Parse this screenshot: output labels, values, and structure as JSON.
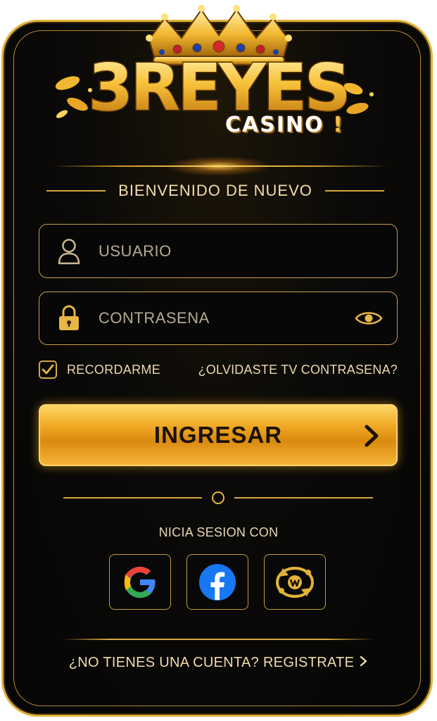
{
  "brand": {
    "logo_main": "3REYES",
    "logo_sub": "CASINO",
    "logo_sub_mark": "!"
  },
  "form": {
    "welcome": "BIENVENIDO DE NUEVO",
    "username_placeholder": "USUARIO",
    "password_placeholder": "CONTRASENA",
    "remember_label": "RECORDARME",
    "remember_checked": true,
    "forgot_link": "¿OLVIDASTE TV CONTRASENA?",
    "login_button": "INGRESAR"
  },
  "social": {
    "label": "NICIA SESION CON",
    "providers": [
      {
        "name": "google",
        "icon": "google-icon"
      },
      {
        "name": "facebook",
        "icon": "facebook-icon"
      },
      {
        "name": "other",
        "icon": "casino-chip-icon"
      }
    ]
  },
  "footer": {
    "register_link": "¿NO TIENES UNA CUENTA? REGISTRATE"
  },
  "colors": {
    "gold": "#e2b33a",
    "background": "#050505",
    "button": "#f0a823",
    "text": "#f5deaa"
  }
}
